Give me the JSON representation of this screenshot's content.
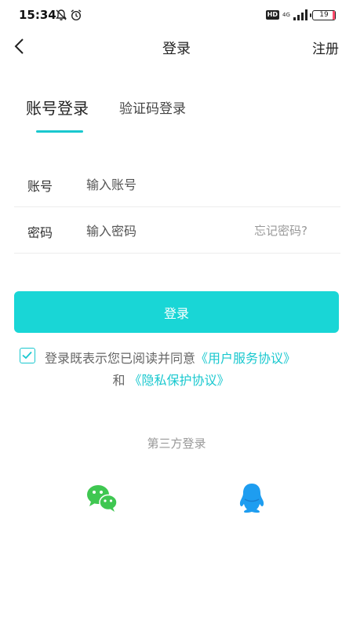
{
  "status_bar": {
    "time": "15:34",
    "hd": "HD",
    "network": "4G",
    "battery": "19"
  },
  "header": {
    "title": "登录",
    "register": "注册"
  },
  "tabs": {
    "account_login": "账号登录",
    "code_login": "验证码登录"
  },
  "form": {
    "account_label": "账号",
    "account_placeholder": "输入账号",
    "password_label": "密码",
    "password_placeholder": "输入密码",
    "forgot": "忘记密码?"
  },
  "login_button": "登录",
  "agreement": {
    "checked": true,
    "prefix": "登录既表示您已阅读并同意",
    "user_agreement": "《用户服务协议》",
    "and": "和",
    "privacy_agreement": "《隐私保护协议》"
  },
  "third_party": {
    "title": "第三方登录",
    "providers": [
      "wechat-icon",
      "qq-icon"
    ]
  },
  "colors": {
    "accent": "#19c8cf",
    "button": "#19d6d6",
    "wechat": "#3fc751",
    "qq": "#1e9df0"
  }
}
